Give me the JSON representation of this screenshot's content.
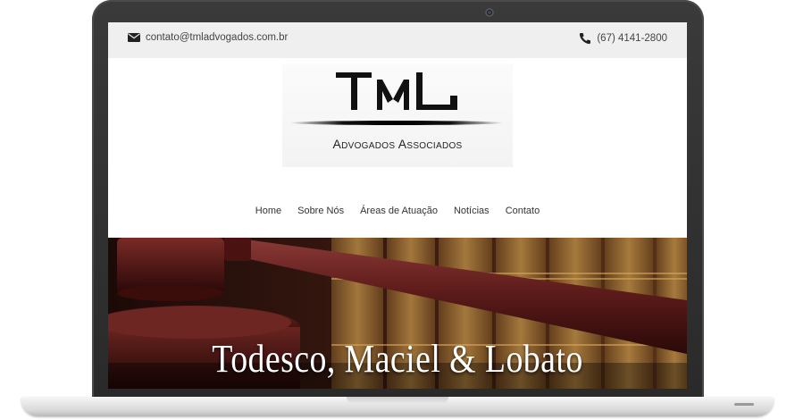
{
  "topbar": {
    "email": "contato@tmladvogados.com.br",
    "phone": "(67) 4141-2800",
    "email_icon": "envelope-icon",
    "phone_icon": "phone-icon"
  },
  "logo": {
    "mark": "TML",
    "subtitle": "Advogados Associados"
  },
  "nav": {
    "items": [
      {
        "label": "Home"
      },
      {
        "label": "Sobre Nós"
      },
      {
        "label": "Áreas de Atuação"
      },
      {
        "label": "Notícias"
      },
      {
        "label": "Contato"
      }
    ]
  },
  "hero": {
    "title": "Todesco, Maciel & Lobato",
    "image": "gavel-and-law-books"
  },
  "colors": {
    "topbar_bg": "#efefef",
    "hero_wood": "#5a1e1a",
    "text_dark": "#333333"
  }
}
